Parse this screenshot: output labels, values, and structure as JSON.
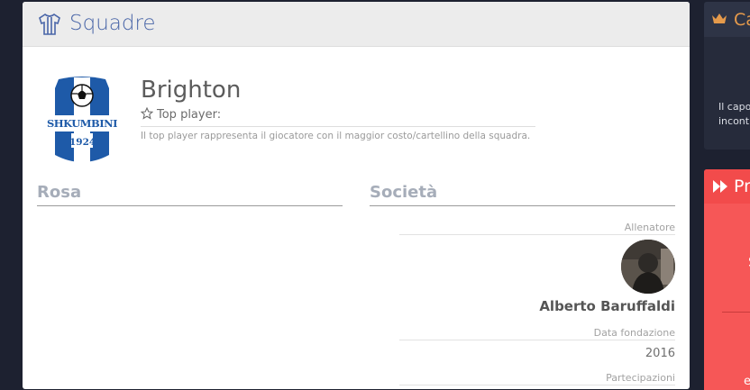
{
  "main": {
    "header_title": "Squadre",
    "team": {
      "name": "Brighton",
      "top_player_label": "Top player:",
      "top_player_description": "Il top player rappresenta il giocatore con il maggior costo/cartellino della squadra.",
      "logo_text": "SHKUMBINI",
      "logo_year": "1924"
    },
    "sections": {
      "rosa": "Rosa",
      "societa": "Società"
    },
    "societa": {
      "allenatore_label": "Allenatore",
      "allenatore_name": "Alberto Baruffaldi",
      "fondazione_label": "Data fondazione",
      "fondazione_value": "2016",
      "partecipazioni_label": "Partecipazioni"
    }
  },
  "side_top": {
    "header_fragment": "Ca",
    "body_line1": "Il capo",
    "body_line2": "incont",
    "accent": "#e59a4b"
  },
  "side_bottom": {
    "header_fragment": "Pr",
    "fragment1": "S",
    "fragment2": "e",
    "accent": "#f65757"
  },
  "icons": [
    "shirt-icon",
    "star-icon",
    "crown-icon",
    "double-arrow-icon"
  ]
}
